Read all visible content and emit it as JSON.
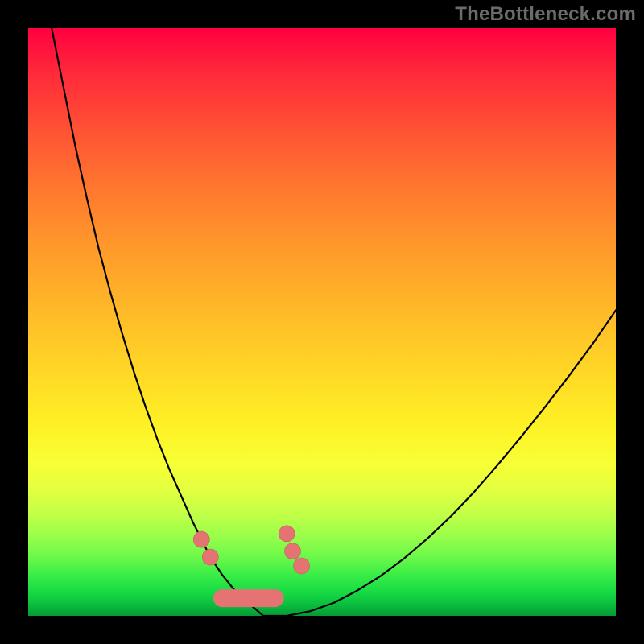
{
  "watermark": "TheBottleneck.com",
  "colors": {
    "background": "#000000",
    "watermark": "#6b6b6b",
    "curve": "#000000",
    "marker": "#e57373",
    "gradient_top": "#ff0040",
    "gradient_bottom": "#069a34"
  },
  "chart_data": {
    "type": "line",
    "title": "",
    "xlabel": "",
    "ylabel": "",
    "xlim": [
      0,
      100
    ],
    "ylim": [
      0,
      100
    ],
    "grid": false,
    "legend": false,
    "series": [
      {
        "name": "bottleneck-curve",
        "x": [
          4,
          6,
          8,
          10,
          12,
          14,
          16,
          18,
          20,
          22,
          24,
          26,
          28,
          29.5,
          31,
          33,
          35,
          37,
          38.5,
          40,
          44,
          48,
          52,
          56,
          60,
          64,
          68,
          72,
          76,
          80,
          84,
          88,
          92,
          96,
          100
        ],
        "values": [
          100,
          90,
          80,
          71,
          62.5,
          55,
          48,
          41.5,
          35.5,
          30,
          25,
          20.5,
          16,
          13,
          10,
          7,
          4.5,
          2.5,
          1.3,
          0,
          0,
          0.8,
          2.2,
          4.3,
          6.8,
          9.8,
          13.2,
          17,
          21.2,
          25.8,
          30.6,
          35.6,
          40.8,
          46.2,
          52
        ]
      }
    ],
    "markers": [
      {
        "x": 29.5,
        "y": 13
      },
      {
        "x": 31,
        "y": 10
      },
      {
        "x": 44,
        "y": 14
      },
      {
        "x": 45,
        "y": 11
      },
      {
        "x": 46.5,
        "y": 8.5
      }
    ],
    "flat_segment": {
      "x_start": 33,
      "x_end": 42,
      "y": 3
    }
  }
}
